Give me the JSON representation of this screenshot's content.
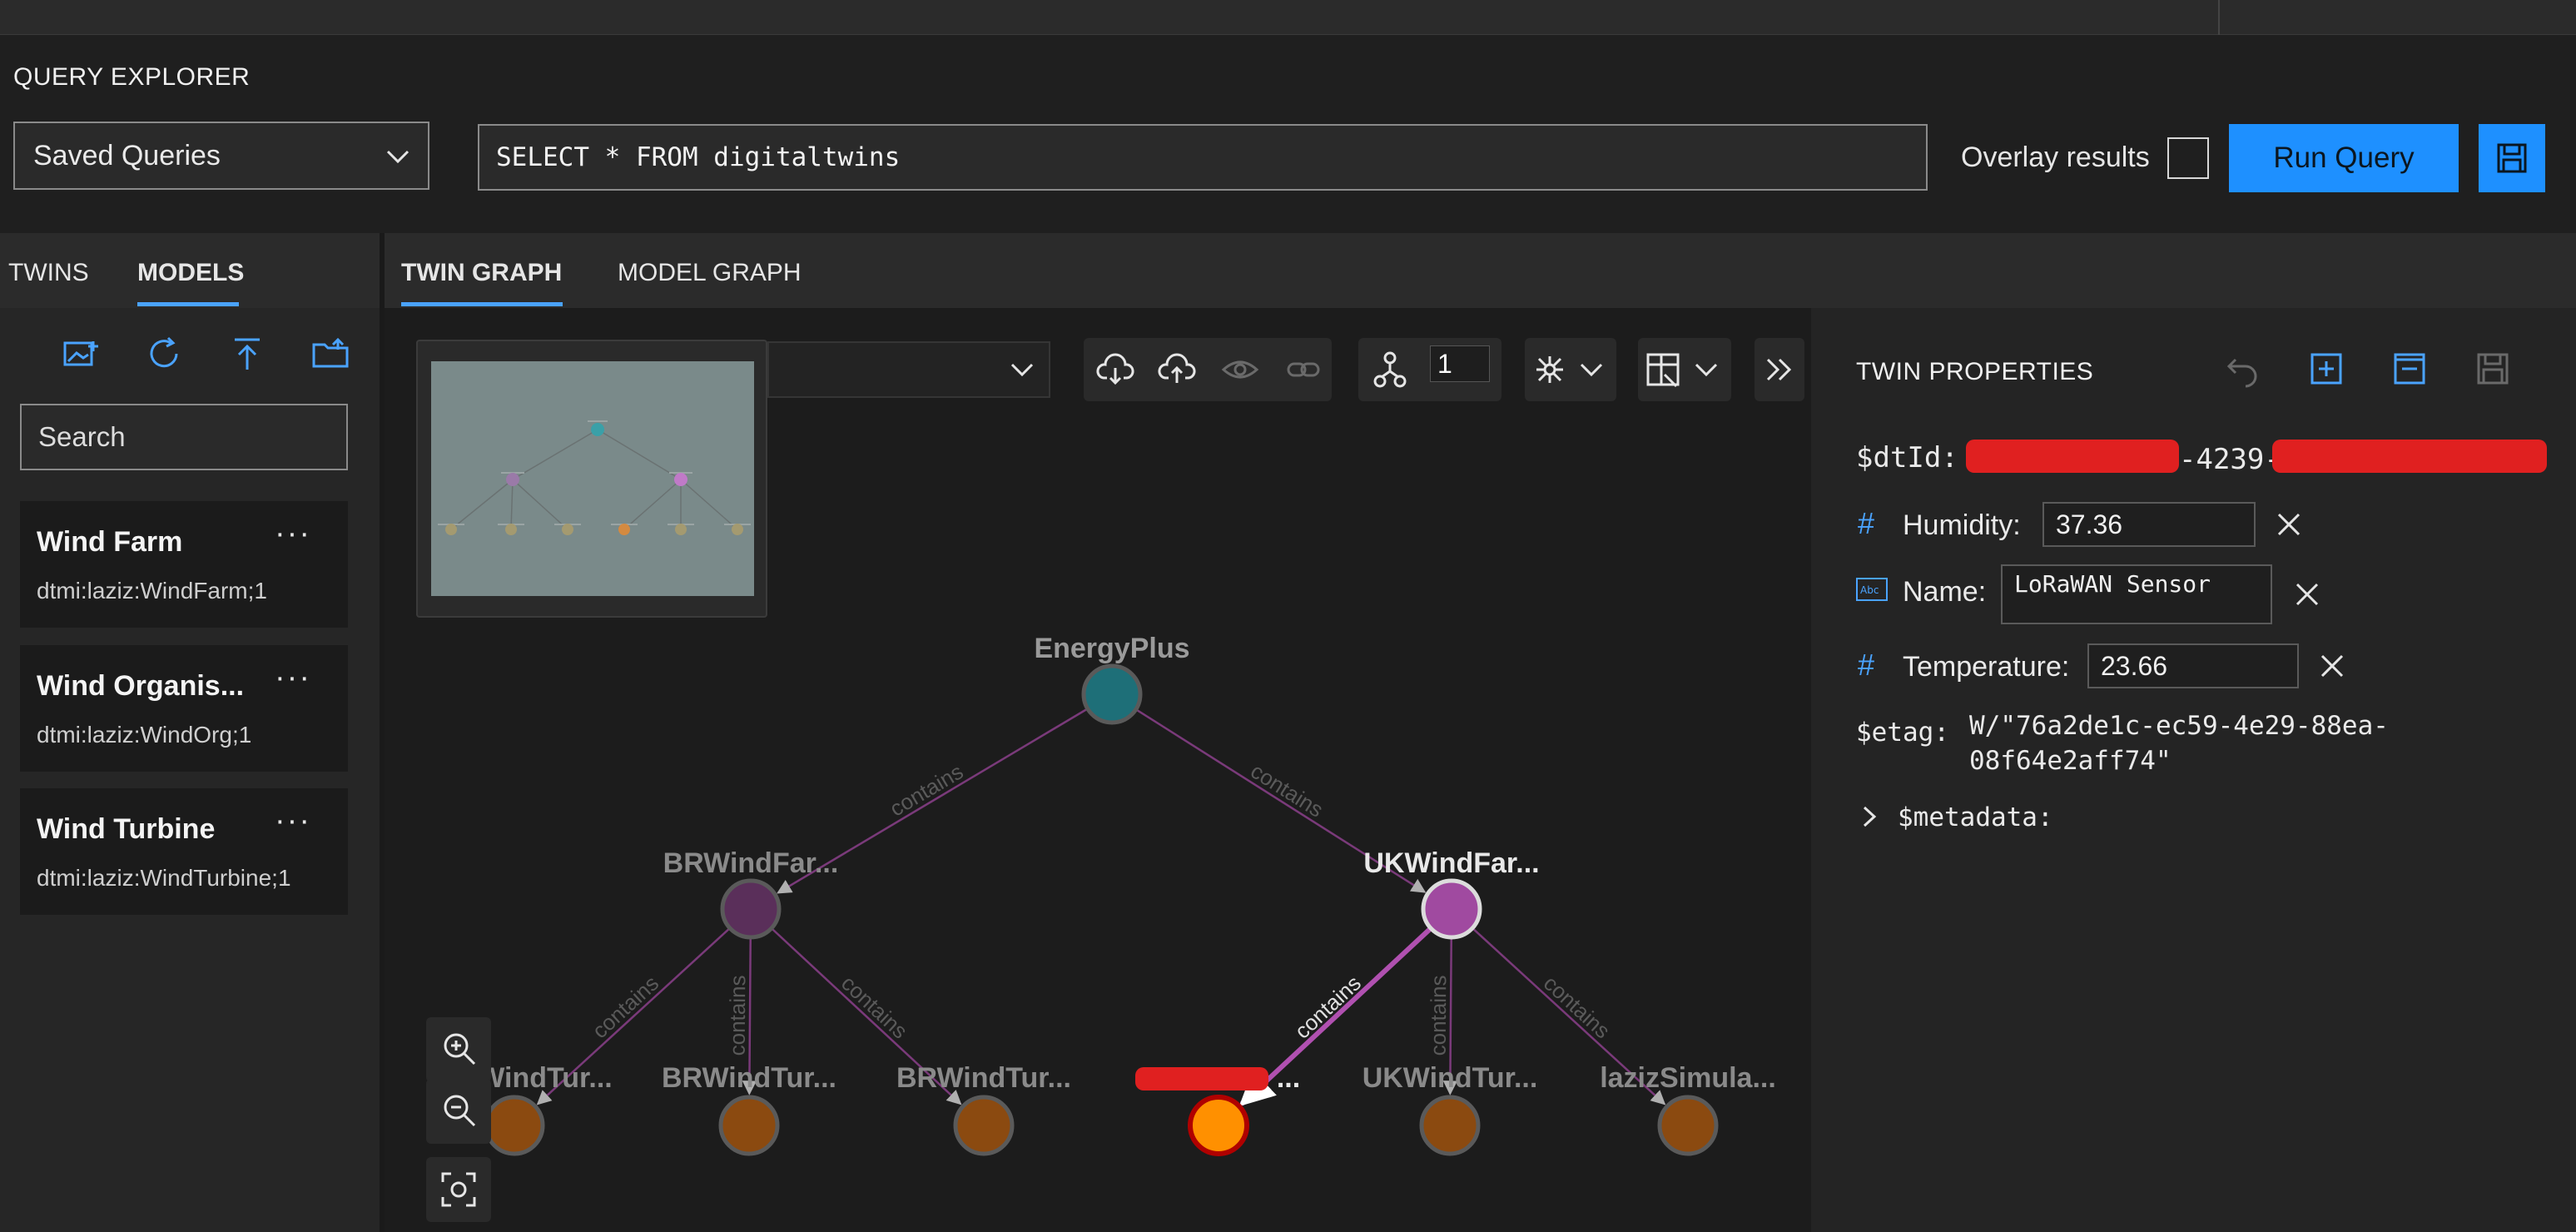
{
  "query_explorer": {
    "title": "QUERY EXPLORER",
    "saved_queries": "Saved Queries",
    "query_text": "SELECT * FROM digitaltwins",
    "overlay_label": "Overlay results",
    "run_label": "Run Query"
  },
  "left_tabs": {
    "twins": "TWINS",
    "models": "MODELS"
  },
  "search_placeholder": "Search",
  "models": [
    {
      "name": "Wind Farm",
      "dtmi": "dtmi:laziz:WindFarm;1"
    },
    {
      "name": "Wind Organis...",
      "dtmi": "dtmi:laziz:WindOrg;1"
    },
    {
      "name": "Wind Turbine",
      "dtmi": "dtmi:laziz:WindTurbine;1"
    }
  ],
  "more_label": "···",
  "graph_tabs": {
    "twin_graph": "TWIN GRAPH",
    "model_graph": "MODEL GRAPH"
  },
  "depth_value": "1",
  "graph": {
    "edge_label": "contains",
    "nodes": {
      "energy": "EnergyPlus",
      "br": "BRWindFar...",
      "uk": "UKWindFar...",
      "t1": "BRWindTur...",
      "t1_visible": "WindTur...",
      "t2": "BRWindTur...",
      "t3": "BRWindTur...",
      "t4_suffix": "...",
      "t5": "UKWindTur...",
      "t6": "lazizSimula..."
    },
    "colors": {
      "root": "#1e6f78",
      "br": "#5a2f5a",
      "uk": "#a04aa0",
      "turbine": "#8b4a10",
      "selected": "#ff9000",
      "edge": "#7a3a7a",
      "edge_selected": "#b050b0"
    }
  },
  "twin_properties": {
    "title": "TWIN PROPERTIES",
    "dtid_label": "$dtId:",
    "dtid_visible": "-4239-",
    "humidity_label": "Humidity:",
    "humidity_value": "37.36",
    "name_label": "Name:",
    "name_value": "LoRaWAN Sensor",
    "temperature_label": "Temperature:",
    "temperature_value": "23.66",
    "etag_label": "$etag:",
    "etag_line1": "W/\"76a2de1c-ec59-4e29-88ea-",
    "etag_line2": "08f64e2aff74\"",
    "metadata_label": "$metadata:"
  }
}
